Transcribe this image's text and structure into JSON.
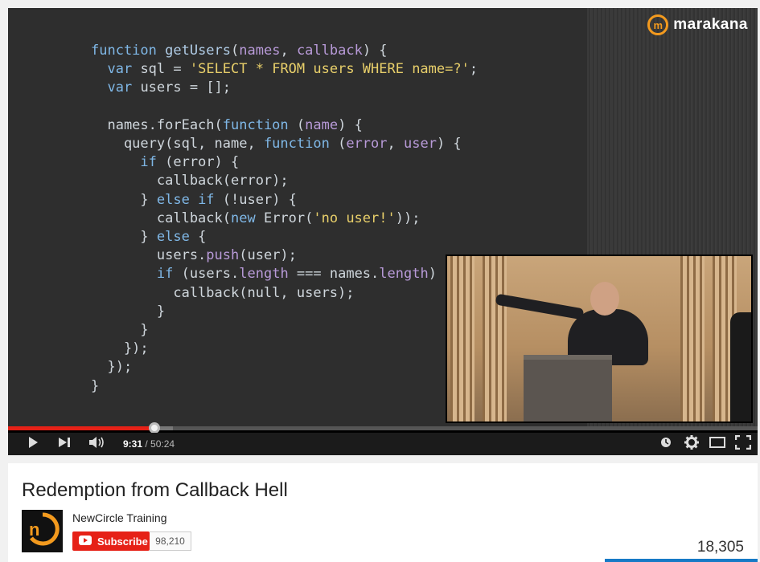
{
  "video": {
    "slide_code": [
      [
        {
          "t": "function ",
          "c": "kw"
        },
        {
          "t": "getUsers",
          "c": "fn"
        },
        {
          "t": "("
        },
        {
          "t": "names",
          "c": "par"
        },
        {
          "t": ", "
        },
        {
          "t": "callback",
          "c": "par"
        },
        {
          "t": ") {"
        }
      ],
      [
        {
          "t": "  "
        },
        {
          "t": "var ",
          "c": "kw"
        },
        {
          "t": "sql = "
        },
        {
          "t": "'SELECT * FROM users WHERE name=?'",
          "c": "str"
        },
        {
          "t": ";"
        }
      ],
      [
        {
          "t": "  "
        },
        {
          "t": "var ",
          "c": "kw"
        },
        {
          "t": "users = []"
        },
        {
          "t": ";"
        }
      ],
      [
        {
          "t": ""
        }
      ],
      [
        {
          "t": "  names.forEach("
        },
        {
          "t": "function ",
          "c": "kw"
        },
        {
          "t": "("
        },
        {
          "t": "name",
          "c": "par"
        },
        {
          "t": ") {"
        }
      ],
      [
        {
          "t": "    query(sql, name, "
        },
        {
          "t": "function ",
          "c": "kw"
        },
        {
          "t": "("
        },
        {
          "t": "error",
          "c": "par"
        },
        {
          "t": ", "
        },
        {
          "t": "user",
          "c": "par"
        },
        {
          "t": ") {"
        }
      ],
      [
        {
          "t": "      "
        },
        {
          "t": "if",
          "c": "kw"
        },
        {
          "t": " (error) {"
        }
      ],
      [
        {
          "t": "        callback(error);"
        }
      ],
      [
        {
          "t": "      } "
        },
        {
          "t": "else if",
          "c": "kw"
        },
        {
          "t": " (!user) {"
        }
      ],
      [
        {
          "t": "        callback("
        },
        {
          "t": "new ",
          "c": "kw"
        },
        {
          "t": "Error("
        },
        {
          "t": "'no user!'",
          "c": "str"
        },
        {
          "t": "));"
        }
      ],
      [
        {
          "t": "      } "
        },
        {
          "t": "else",
          "c": "kw"
        },
        {
          "t": " {"
        }
      ],
      [
        {
          "t": "        users."
        },
        {
          "t": "push",
          "c": "par"
        },
        {
          "t": "(user);"
        }
      ],
      [
        {
          "t": "        "
        },
        {
          "t": "if",
          "c": "kw"
        },
        {
          "t": " (users."
        },
        {
          "t": "length",
          "c": "par"
        },
        {
          "t": " === names."
        },
        {
          "t": "length",
          "c": "par"
        },
        {
          "t": ")"
        }
      ],
      [
        {
          "t": "          callback(null, users);"
        }
      ],
      [
        {
          "t": "        }"
        }
      ],
      [
        {
          "t": "      }"
        }
      ],
      [
        {
          "t": "    });"
        }
      ],
      [
        {
          "t": "  });"
        }
      ],
      [
        {
          "t": "}"
        }
      ]
    ],
    "watermark": {
      "logo_letter": "m",
      "brand": "marakana"
    }
  },
  "player": {
    "progress_played_fraction": 0.195,
    "progress_buffered_fraction": 0.22,
    "time_current": "9:31",
    "time_separator": " / ",
    "time_total": "50:24",
    "icons": [
      "play-icon",
      "next-icon",
      "volume-icon",
      "watch-later-icon",
      "settings-icon",
      "theater-mode-icon",
      "fullscreen-icon"
    ]
  },
  "info": {
    "title": "Redemption from Callback Hell",
    "channel_name": "NewCircle Training",
    "channel_logo_letter": "n",
    "subscribe_label": "Subscribe",
    "subscriber_count": "98,210",
    "view_count": "18,305"
  },
  "colors": {
    "accent": "#e62117",
    "brand_orange": "#f39a1e",
    "like_bar": "#167ac6"
  }
}
